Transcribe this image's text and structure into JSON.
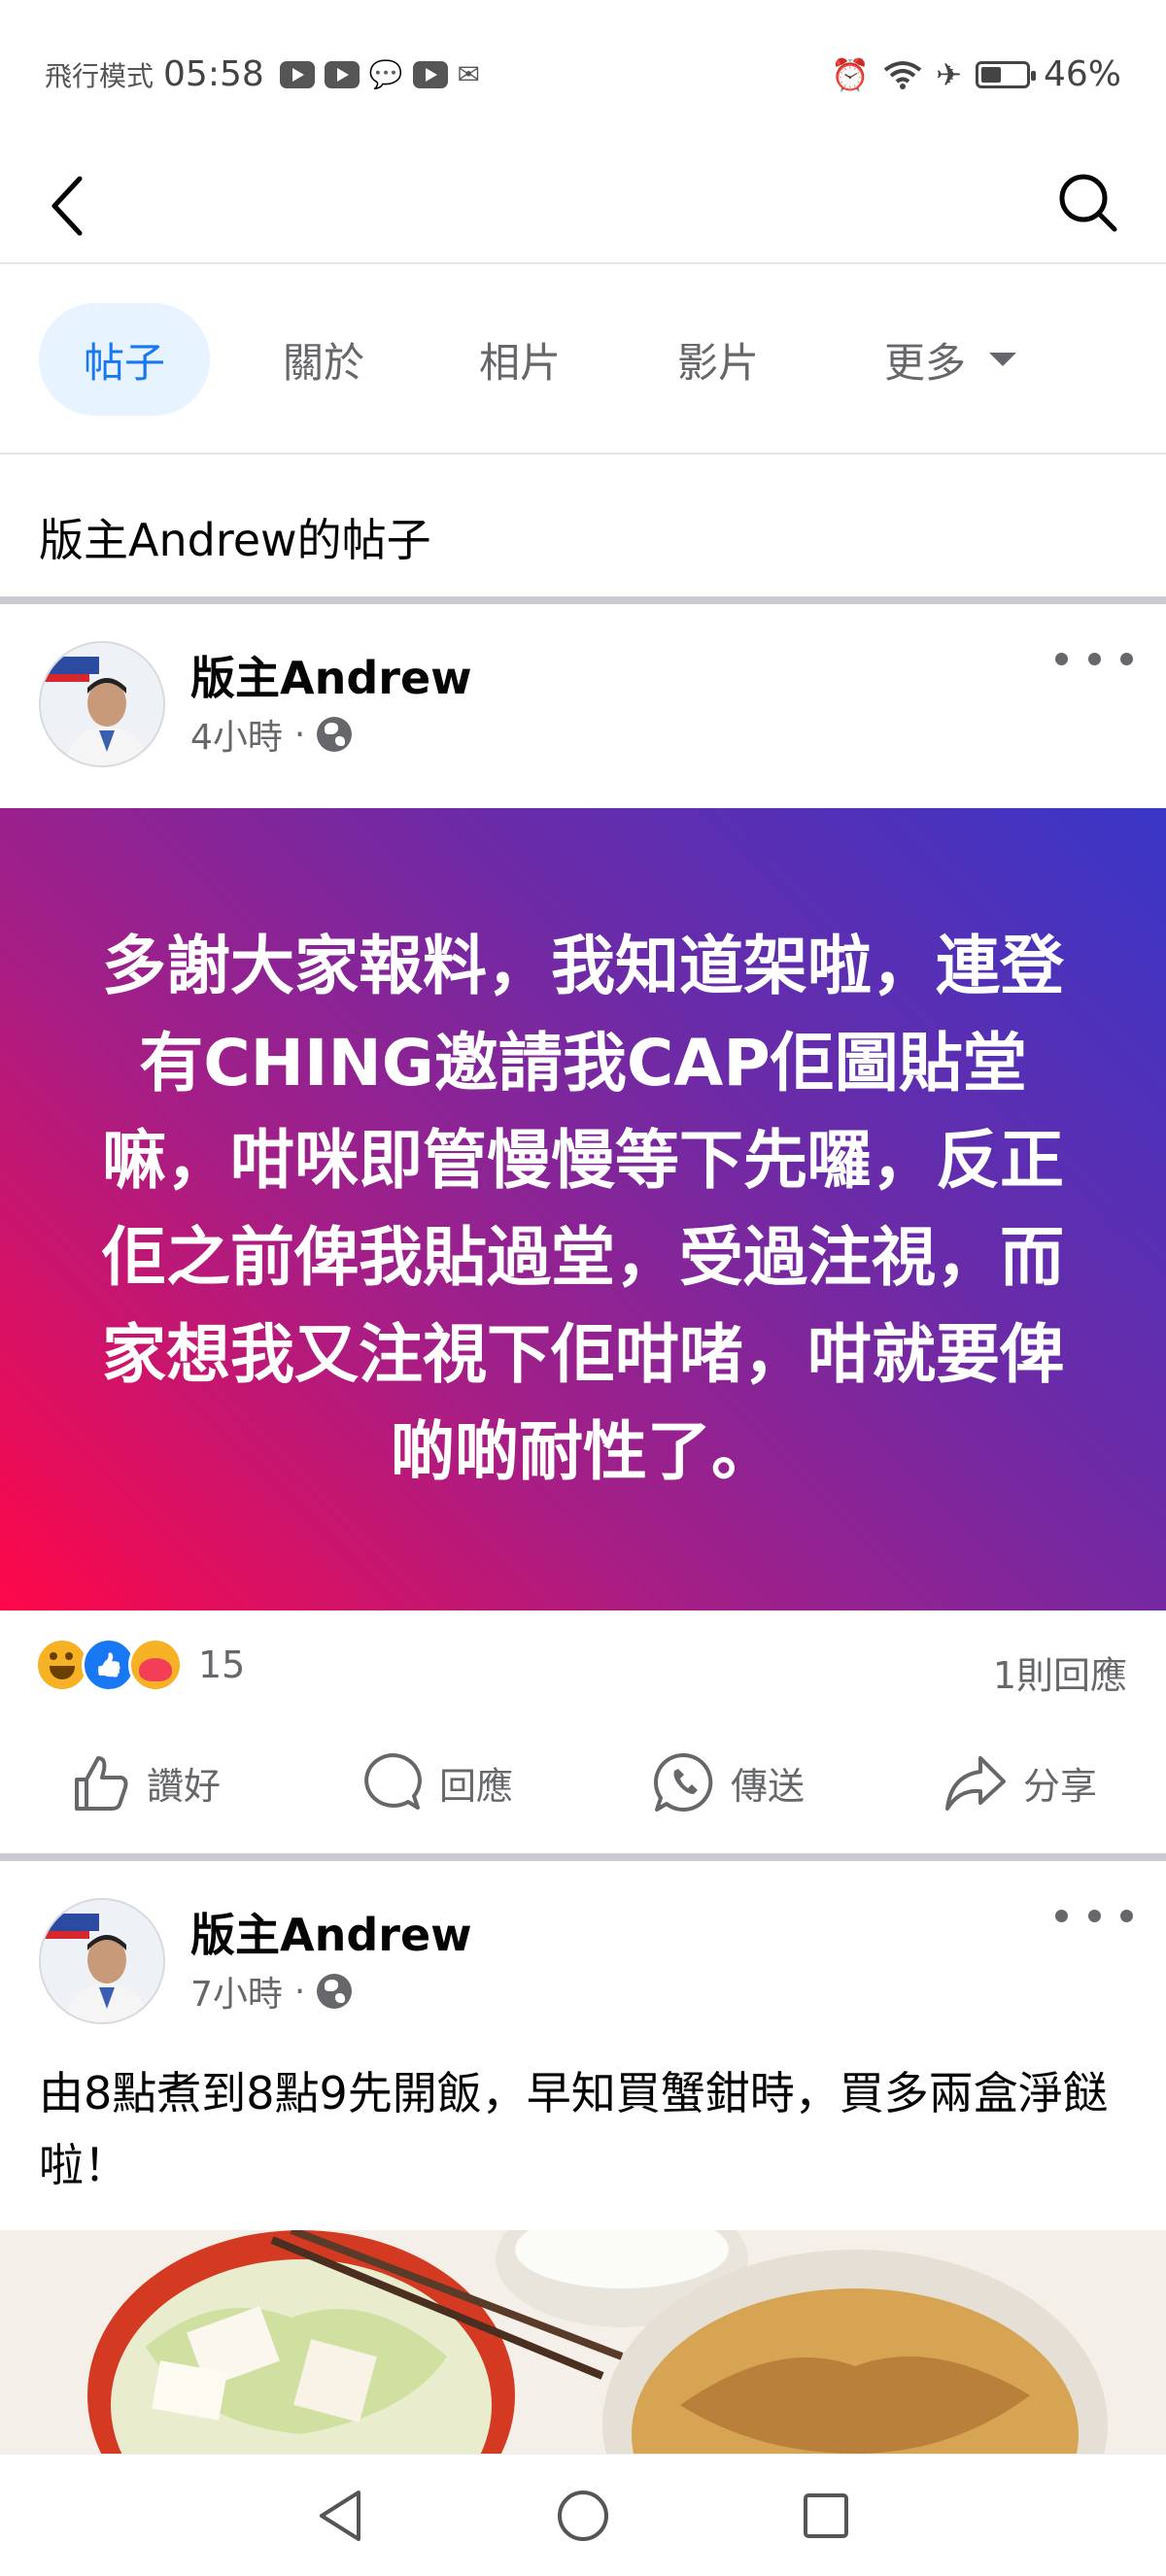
{
  "status_bar": {
    "mode": "飛行模式",
    "time": "05:58",
    "battery": "46%",
    "battery_level": 0.46,
    "icons": [
      "youtube-icon",
      "youtube-icon",
      "wechat-icon",
      "youtube-icon",
      "gmail-icon",
      "alarm-icon",
      "wifi-icon",
      "airplane-icon",
      "battery-icon"
    ]
  },
  "header": {
    "back_icon": "chevron-left-icon",
    "search_icon": "search-icon"
  },
  "tabs": [
    {
      "label": "帖子",
      "active": true
    },
    {
      "label": "關於",
      "active": false
    },
    {
      "label": "相片",
      "active": false
    },
    {
      "label": "影片",
      "active": false
    },
    {
      "label": "更多",
      "active": false
    }
  ],
  "section_title": "版主Andrew的帖子",
  "posts": [
    {
      "author": "版主Andrew",
      "time": "4小時",
      "separator": "·",
      "text": "多謝大家報料，我知道架啦，連登有CHING邀請我CAP佢圖貼堂嘛，咁咪即管慢慢等下先囉，反正佢之前俾我貼過堂，受過注視，而家想我又注視下佢咁啫，咁就要俾啲啲耐性了。",
      "reaction_count": "15",
      "comment_count": "1則回應"
    },
    {
      "author": "版主Andrew",
      "time": "7小時",
      "separator": "·",
      "text": "由8點煮到8點9先開飯，早知買蟹鉗時，買多兩盒淨餸啦！"
    }
  ],
  "actions": {
    "like": "讚好",
    "comment": "回應",
    "send": "傳送",
    "share": "分享"
  },
  "colors": {
    "accent": "#1877f2",
    "tab_active_bg": "#e7f3ff",
    "secondary_text": "#65676b",
    "gradient_start": "#3a36c7",
    "gradient_end": "#ff0749"
  }
}
